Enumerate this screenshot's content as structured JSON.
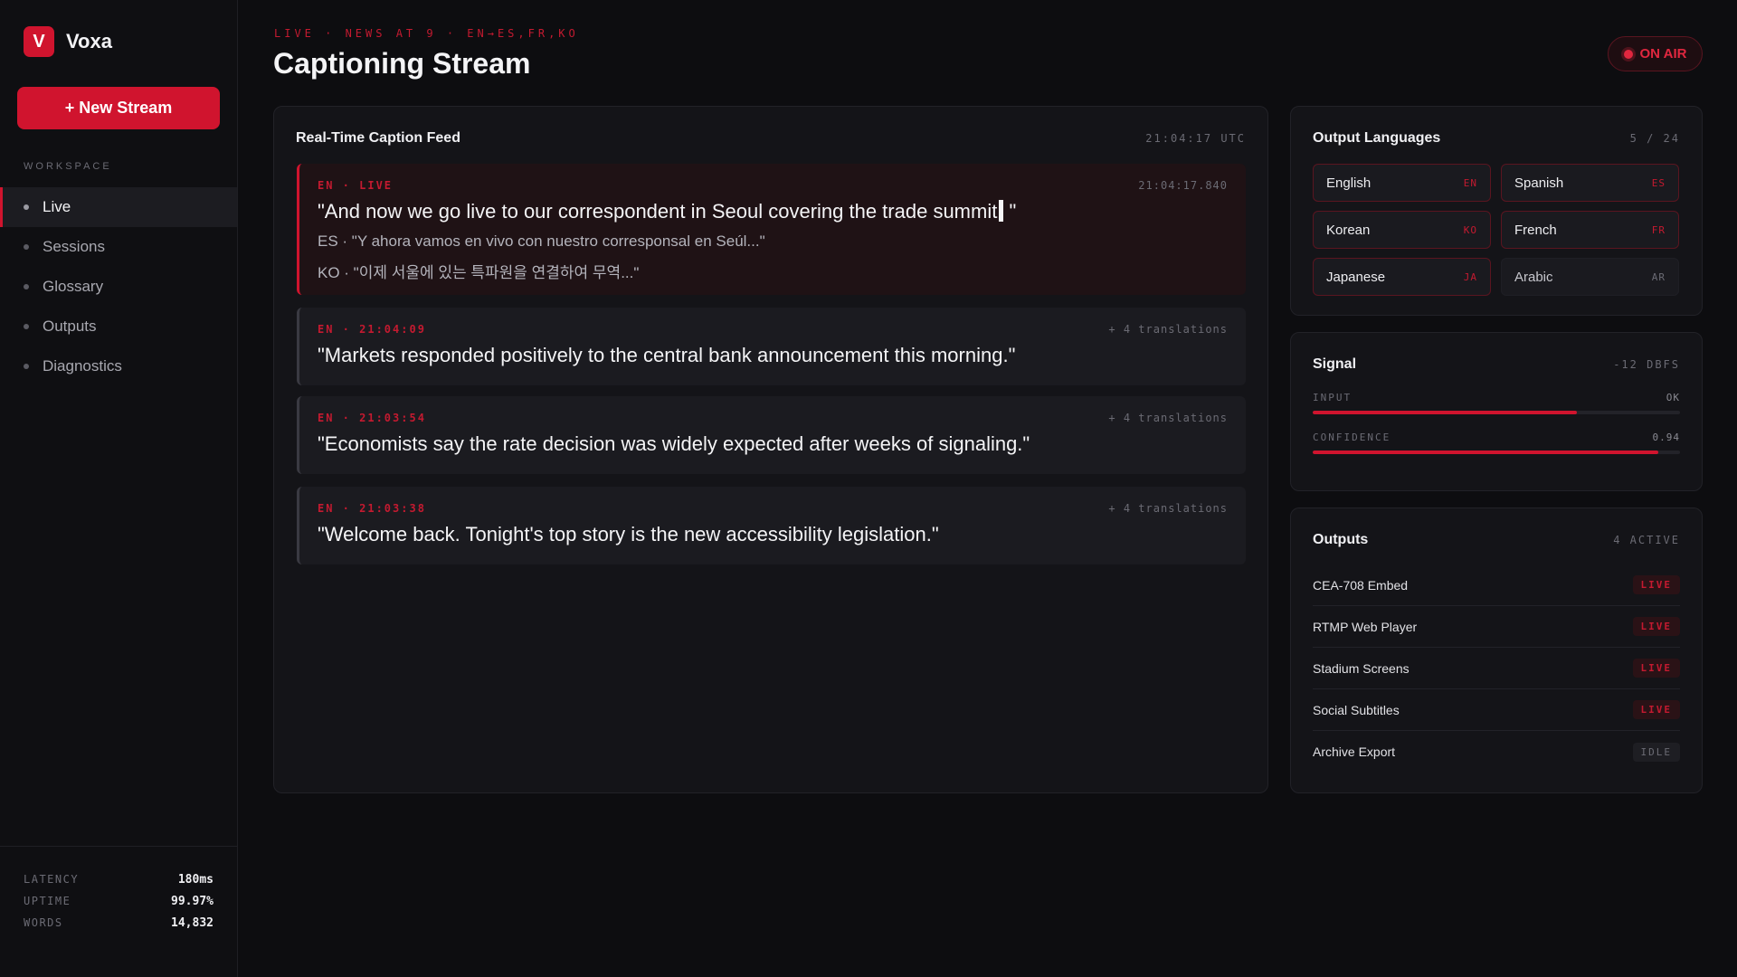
{
  "brand": {
    "logo_letter": "V",
    "name": "Voxa"
  },
  "sidebar": {
    "new_stream_label": "+ New Stream",
    "section_label": "WORKSPACE",
    "items": [
      {
        "label": "Live",
        "active": true
      },
      {
        "label": "Sessions",
        "active": false
      },
      {
        "label": "Glossary",
        "active": false
      },
      {
        "label": "Outputs",
        "active": false
      },
      {
        "label": "Diagnostics",
        "active": false
      }
    ],
    "stats": [
      {
        "label": "LATENCY",
        "value": "180ms"
      },
      {
        "label": "UPTIME",
        "value": "99.97%"
      },
      {
        "label": "WORDS",
        "value": "14,832"
      }
    ]
  },
  "header": {
    "eyebrow": "LIVE · NEWS AT 9 · EN→ES,FR,KO",
    "title": "Captioning Stream",
    "status": "ON AIR"
  },
  "feed": {
    "title": "Real-Time Caption Feed",
    "clock": "21:04:17 UTC",
    "captions": [
      {
        "tag": "EN · LIVE",
        "right": "21:04:17.840",
        "text": "\"And now we go live to our correspondent in Seoul covering the trade summit",
        "text_after_cursor": " \"",
        "translations": [
          "ES · \"Y ahora vamos en vivo con nuestro corresponsal en Seúl...\"",
          "KO · \"이제 서울에 있는 특파원을 연결하여 무역...\""
        ]
      },
      {
        "tag": "EN · 21:04:09",
        "right": "+ 4 translations",
        "text": "\"Markets responded positively to the central bank announcement this morning.\""
      },
      {
        "tag": "EN · 21:03:54",
        "right": "+ 4 translations",
        "text": "\"Economists say the rate decision was widely expected after weeks of signaling.\""
      },
      {
        "tag": "EN · 21:03:38",
        "right": "+ 4 translations",
        "text": "\"Welcome back. Tonight's top story is the new accessibility legislation.\""
      }
    ]
  },
  "languages": {
    "title": "Output Languages",
    "count": "5 / 24",
    "items": [
      {
        "name": "English",
        "code": "EN",
        "enabled": true
      },
      {
        "name": "Spanish",
        "code": "ES",
        "enabled": true
      },
      {
        "name": "Korean",
        "code": "KO",
        "enabled": true
      },
      {
        "name": "French",
        "code": "FR",
        "enabled": true
      },
      {
        "name": "Japanese",
        "code": "JA",
        "enabled": true
      },
      {
        "name": "Arabic",
        "code": "AR",
        "enabled": false
      }
    ]
  },
  "signal": {
    "title": "Signal",
    "level": "-12 DBFS",
    "input": {
      "label": "INPUT",
      "value": "OK",
      "fill_fraction": 0.72
    },
    "confidence": {
      "label": "CONFIDENCE",
      "value": "0.94",
      "fill_fraction": 0.94
    }
  },
  "outputs": {
    "title": "Outputs",
    "count": "4 ACTIVE",
    "items": [
      {
        "name": "CEA-708 Embed",
        "status": "LIVE"
      },
      {
        "name": "RTMP Web Player",
        "status": "LIVE"
      },
      {
        "name": "Stadium Screens",
        "status": "LIVE"
      },
      {
        "name": "Social Subtitles",
        "status": "LIVE"
      },
      {
        "name": "Archive Export",
        "status": "IDLE"
      }
    ]
  },
  "colors": {
    "accent": "#d0142e",
    "background": "#0d0d10",
    "panel": "#141418"
  }
}
